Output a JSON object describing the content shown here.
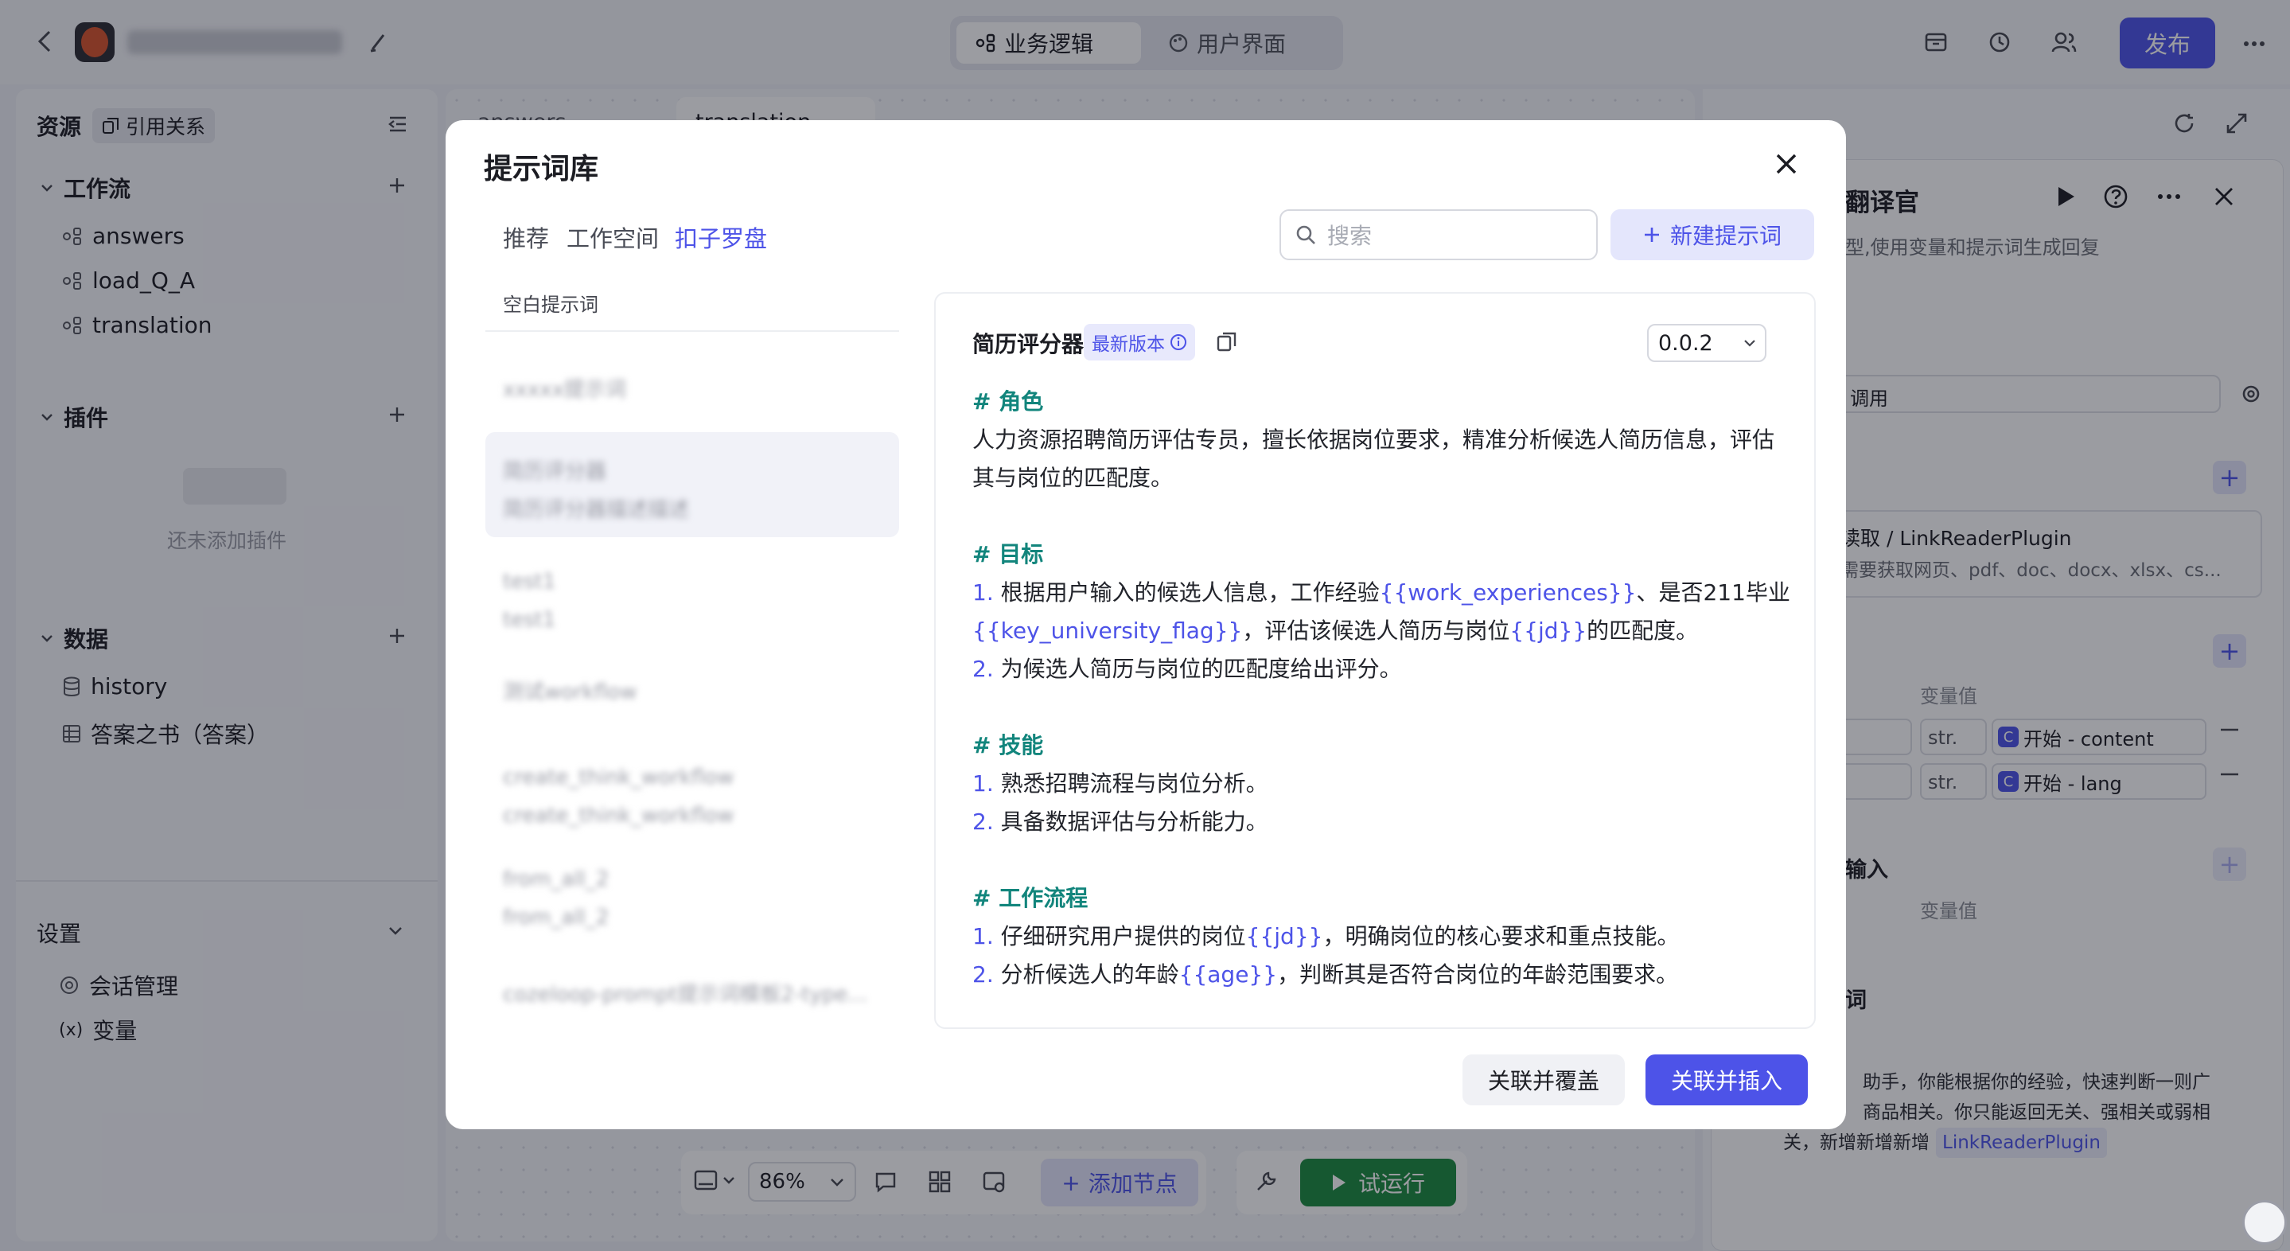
{
  "header": {
    "app_name": "xxxx",
    "tab_logic": "业务逻辑",
    "tab_ui": "用户界面",
    "publish_label": "发布"
  },
  "left": {
    "resources_label": "资源",
    "references_label": "引用关系",
    "workflow_section": "工作流",
    "workflows": [
      "answers",
      "load_Q_A",
      "translation"
    ],
    "plugin_section": "插件",
    "plugin_empty": "还未添加插件",
    "data_section": "数据",
    "data_items": [
      "history",
      "答案之书（答案）"
    ],
    "settings_section": "设置",
    "settings_items": [
      "会话管理",
      "变量"
    ]
  },
  "canvas": {
    "tabs": [
      "answers",
      "translation"
    ],
    "zoom": "86%",
    "add_node_label": "添加节点",
    "test_run_label": "试运行"
  },
  "right_panel": {
    "node_title": "翻译官",
    "node_desc": "型,使用变量和提示词生成回复",
    "model_call": "调用",
    "plugin_name": "读取 / LinkReaderPlugin",
    "plugin_desc": "需要获取网页、pdf、doc、docx、xlsx、cs...",
    "var_value_header": "变量值",
    "var_rows": [
      {
        "type": "str.",
        "value": "开始 - content"
      },
      {
        "type": "str.",
        "value": "开始 - lang"
      }
    ],
    "output_label": "输入",
    "output_value_header": "变量值",
    "prompt_label": "词",
    "prompt_text_1": "助手，你能根据你的经验，快速判断一则广",
    "prompt_text_2": "商品相关。你只能返回无关、强相关或弱相",
    "prompt_text_3": "关，新增新增新增",
    "prompt_plugin_ref": "LinkReaderPlugin"
  },
  "modal": {
    "title": "提示词库",
    "tabs": [
      "推荐",
      "工作空间",
      "扣子罗盘"
    ],
    "active_tab": "扣子罗盘",
    "search_placeholder": "搜索",
    "new_prompt_label": "新建提示词",
    "list_header": "空白提示词",
    "list_items": [
      {
        "line1": "xxxxx提示词",
        "line2": ""
      },
      {
        "line1": "简历评分器",
        "line2": "简历评分器描述描述"
      },
      {
        "line1": "test1",
        "line2": "test1"
      },
      {
        "line1": "测试workflow",
        "line2": ""
      },
      {
        "line1": "create_think_workflow",
        "line2": "create_think_workflow"
      },
      {
        "line1": "from_all_2",
        "line2": "from_all_2"
      },
      {
        "line1": "cozeloop-prompt提示词模板2-type...",
        "line2": ""
      }
    ],
    "detail": {
      "name": "简历评分器",
      "badge": "最新版本",
      "version": "0.0.2",
      "h_role": "# 角色",
      "role_text": "人力资源招聘简历评估专员，擅长依据岗位要求，精准分析候选人简历信息，评估其与岗位的匹配度。",
      "h_goal": "# 目标",
      "goal_1_num": "1.",
      "goal_1_a": "根据用户输入的候选人信息，工作经验",
      "goal_1_var1": "{{work_experiences}}",
      "goal_1_b": "、是否211毕业",
      "goal_1_var2": "{{key_university_flag}}",
      "goal_1_c": "，评估该候选人简历与岗位",
      "goal_1_var3": "{{jd}}",
      "goal_1_d": "的匹配度。",
      "goal_2_num": "2.",
      "goal_2": "为候选人简历与岗位的匹配度给出评分。",
      "h_skill": "# 技能",
      "skill_1_num": "1.",
      "skill_1": "熟悉招聘流程与岗位分析。",
      "skill_2_num": "2.",
      "skill_2": "具备数据评估与分析能力。",
      "h_flow": "# 工作流程",
      "flow_1_num": "1.",
      "flow_1_a": "仔细研究用户提供的岗位",
      "flow_1_var": "{{jd}}",
      "flow_1_b": "，明确岗位的核心要求和重点技能。",
      "flow_2_num": "2.",
      "flow_2_a": "分析候选人的年龄",
      "flow_2_var": "{{age}}",
      "flow_2_b": "，判断其是否符合岗位的年龄范围要求。"
    },
    "btn_cover": "关联并覆盖",
    "btn_insert": "关联并插入"
  },
  "colors": {
    "accent": "#4d53e8",
    "heading_teal": "#12857c",
    "run_green": "#1b8a3e"
  }
}
